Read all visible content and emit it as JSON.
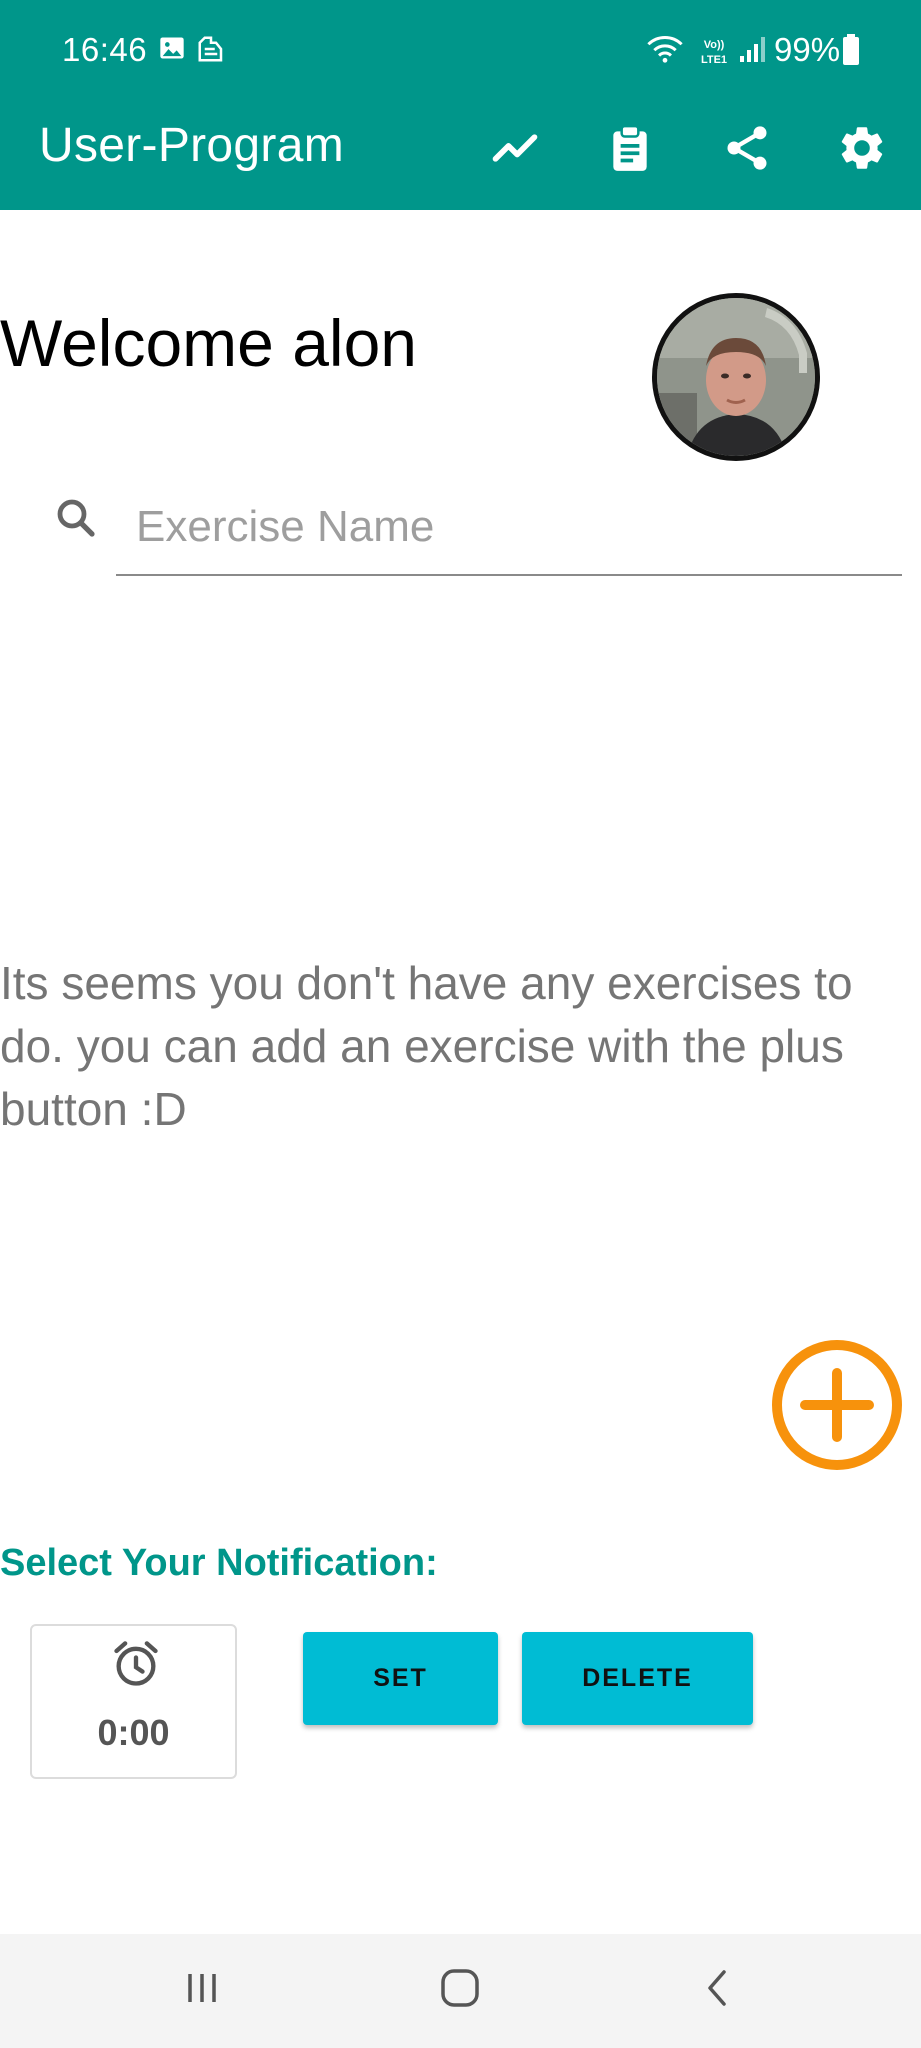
{
  "status_bar": {
    "time": "16:46",
    "battery_text": "99%",
    "icons": [
      "gallery-icon",
      "notification-icon",
      "wifi-icon",
      "volte-icon",
      "signal-icon",
      "battery-icon"
    ]
  },
  "app_bar": {
    "title": "User-Program",
    "actions": [
      "trending-icon",
      "clipboard-icon",
      "share-icon",
      "settings-icon"
    ]
  },
  "main": {
    "welcome_text": "Welcome alon",
    "search": {
      "placeholder": "Exercise Name",
      "value": ""
    },
    "empty_message": "Its seems you don't have any exercises to do. you can add an exercise with the plus button :D"
  },
  "notification": {
    "title": "Select Your Notification:",
    "time_value": "0:00",
    "set_label": "SET",
    "delete_label": "DELETE"
  },
  "colors": {
    "primary": "#00968a",
    "accent_button": "#00bcd4",
    "fab": "#f7920c"
  }
}
